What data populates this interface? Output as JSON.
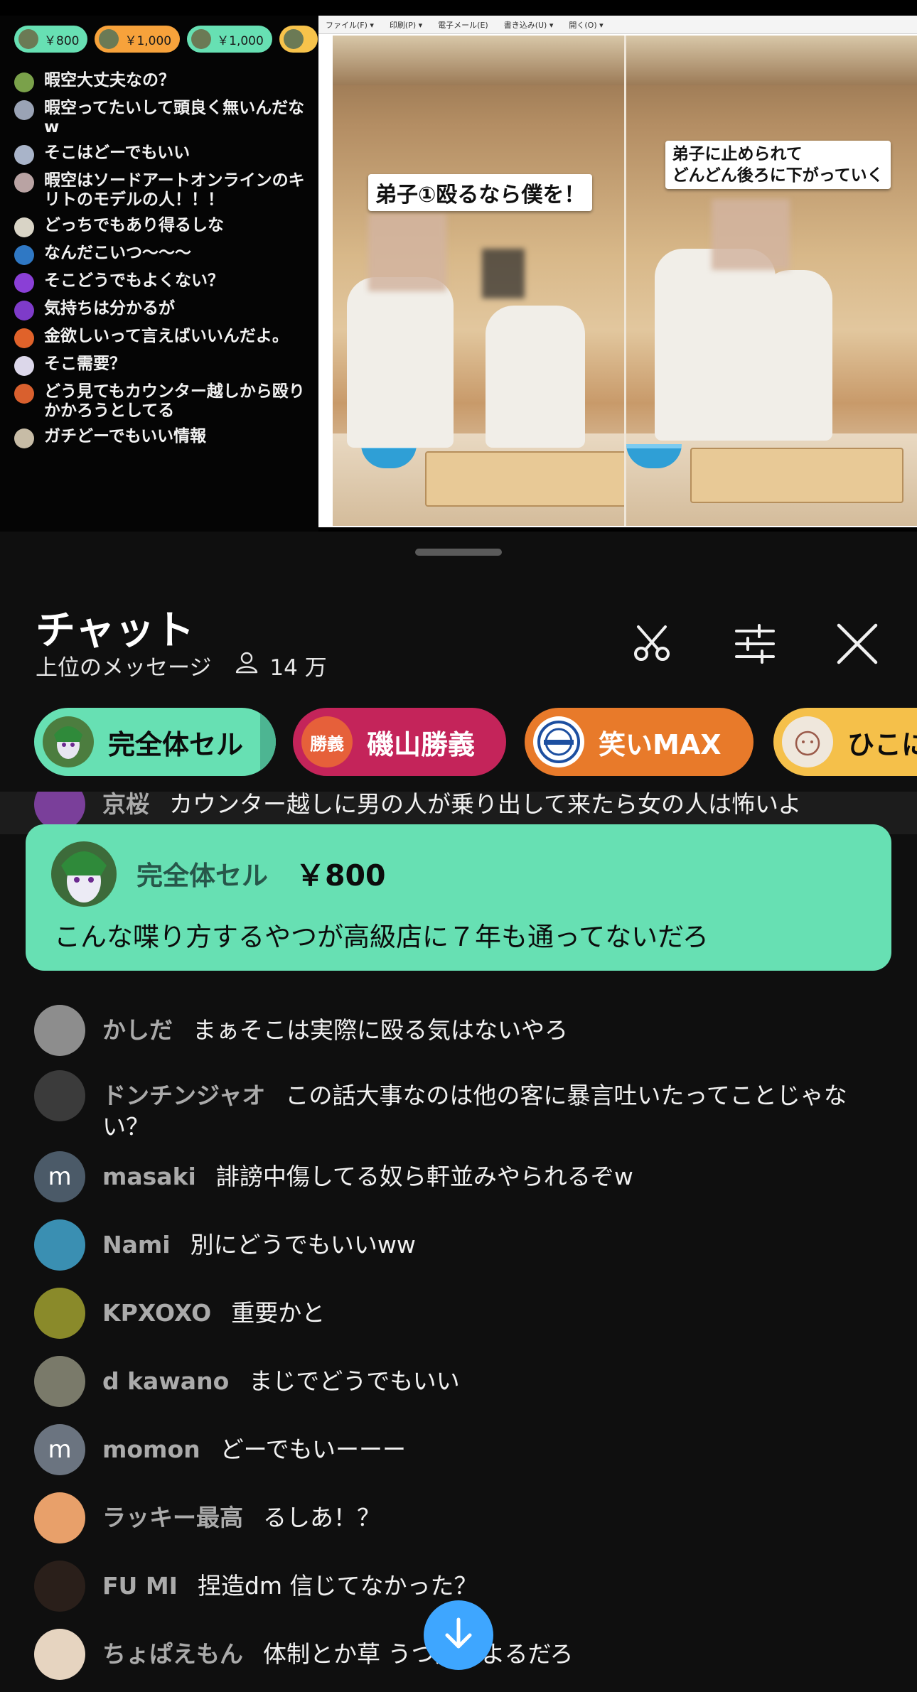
{
  "video": {
    "stream_chat": {
      "chips": [
        {
          "amount": "￥800",
          "color": "#67e0b3"
        },
        {
          "amount": "￥1,000",
          "color": "#f7a23b"
        },
        {
          "amount": "￥1,000",
          "color": "#67e0b3"
        },
        {
          "amount": "",
          "color": "#f7c34b"
        }
      ],
      "messages": [
        {
          "text": "暇空大丈夫なの？",
          "color": "#7aa14a"
        },
        {
          "text": "暇空ってたいして頭良く無いんだなw",
          "color": "#9aa3b5"
        },
        {
          "text": "そこはどーでもいい",
          "color": "#a9b4c9"
        },
        {
          "text": "暇空はソードアートオンラインのキリトのモデルの人！！！",
          "color": "#b9a3a3"
        },
        {
          "text": "どっちでもあり得るしな",
          "color": "#d9d4c6"
        },
        {
          "text": "なんだこいつ〜〜〜",
          "color": "#2f78c4"
        },
        {
          "text": "そこどうでもよくない？",
          "color": "#8a3fd6"
        },
        {
          "text": "気持ちは分かるが",
          "color": "#7e3bc9"
        },
        {
          "text": "金欲しいって言えばいいんだよ。",
          "color": "#e0622a"
        },
        {
          "text": "そこ需要？",
          "color": "#dcd7ea"
        },
        {
          "text": "どう見てもカウンター越しから殴りかかろうとしてる",
          "color": "#d9602e"
        },
        {
          "text": "ガチどーでもいい情報",
          "color": "#c7bca6"
        }
      ]
    },
    "menu": [
      "ファイル(F) ▾",
      "印刷(P) ▾",
      "電子メール(E)",
      "書き込み(U) ▾",
      "開く(O) ▾"
    ],
    "captions": {
      "left": "弟子①殴るなら僕を！",
      "right_line1": "弟子に止められて",
      "right_line2": "どんどん後ろに下がっていく"
    }
  },
  "panel": {
    "title": "チャット",
    "mode": "上位のメッセージ",
    "viewers": "14 万",
    "icons": [
      "scissors-icon",
      "tune-icon",
      "close-icon"
    ]
  },
  "pinned": [
    {
      "name": "完全体セル",
      "bg": "#67e0b3",
      "fg": "#0c0c0c"
    },
    {
      "name": "磯山勝義",
      "bg": "#c4245a",
      "fg": "#ffffff",
      "avatar_text": "勝義"
    },
    {
      "name": "笑いMAX",
      "bg": "#e87a2a",
      "fg": "#ffffff"
    },
    {
      "name": "ひこに",
      "bg": "#f5c04a",
      "fg": "#0c0c0c"
    }
  ],
  "messages_top": {
    "name": "京桜",
    "text": "カウンター越しに男の人が乗り出して来たら女の人は怖いよ"
  },
  "superchat": {
    "name": "完全体セル",
    "amount": "￥800",
    "text": "こんな喋り方するやつが高級店に７年も通ってないだろ",
    "color": "#67e0b3"
  },
  "messages": [
    {
      "name": "かしだ",
      "text": "まぁそこは実際に殴る気はないやろ",
      "avatar": "#8d8d8d"
    },
    {
      "name": "ドンチンジャオ",
      "text": "この話大事なのは他の客に暴言吐いたってことじゃない？",
      "avatar": "#3b3b3b"
    },
    {
      "name": "masaki",
      "text": "誹謗中傷してる奴ら軒並みやられるぞw",
      "avatar": "#4b5a68",
      "letter": "m"
    },
    {
      "name": "Nami",
      "text": "別にどうでもいいww",
      "avatar": "#3a8fb2"
    },
    {
      "name": "KPXOXO",
      "text": "重要かと",
      "avatar": "#8a8a2a"
    },
    {
      "name": "d kawano",
      "text": "まじでどうでもいい",
      "avatar": "#7a7a6a"
    },
    {
      "name": "momon",
      "text": "どーでもいーーー",
      "avatar": "#6b7480",
      "letter": "m"
    },
    {
      "name": "ラッキー最高",
      "text": "るしあ！？",
      "avatar": "#e8a06a"
    },
    {
      "name": "FU MI",
      "text": "捏造dm 信じてなかった？",
      "avatar": "#2a1f1a"
    },
    {
      "name": "ちょぱえもん",
      "text": "体制とか草 うつ病によるだろ",
      "avatar": "#e6d4c0"
    }
  ],
  "accent": "#3ea6ff"
}
